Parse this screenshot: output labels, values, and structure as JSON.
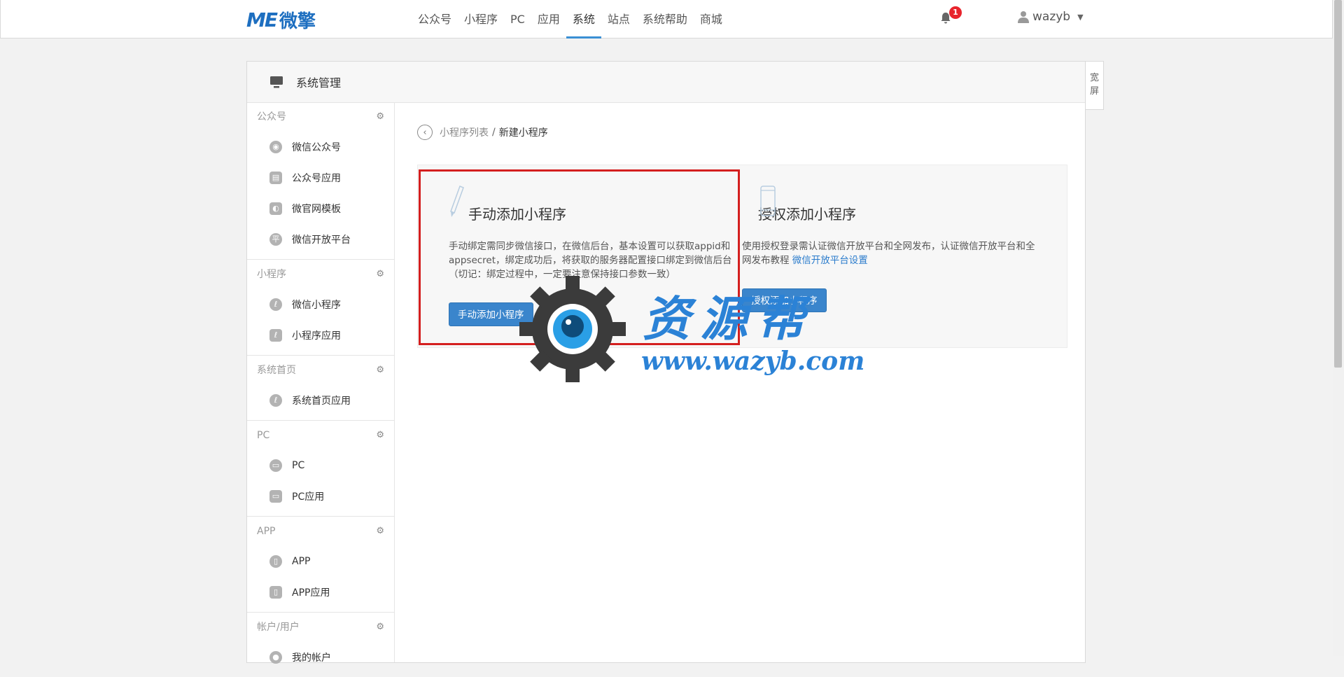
{
  "brand": {
    "mark": "ME",
    "name": "微擎"
  },
  "nav": {
    "items": [
      "公众号",
      "小程序",
      "PC",
      "应用",
      "系统",
      "站点",
      "系统帮助",
      "商城"
    ],
    "active_index": 4
  },
  "notifications": {
    "count": "1"
  },
  "user": {
    "name": "wazyb"
  },
  "panel": {
    "title": "系统管理",
    "wide_toggle": "宽屏"
  },
  "sidebar": {
    "groups": [
      {
        "title": "公众号",
        "items": [
          "微信公众号",
          "公众号应用",
          "微官网模板",
          "微信开放平台"
        ]
      },
      {
        "title": "小程序",
        "items": [
          "微信小程序",
          "小程序应用"
        ]
      },
      {
        "title": "系统首页",
        "items": [
          "系统首页应用"
        ]
      },
      {
        "title": "PC",
        "items": [
          "PC",
          "PC应用"
        ]
      },
      {
        "title": "APP",
        "items": [
          "APP",
          "APP应用"
        ]
      },
      {
        "title": "帐户/用户",
        "items": [
          "我的帐户"
        ]
      }
    ]
  },
  "breadcrumb": {
    "parent": "小程序列表",
    "separator": "/",
    "current": "新建小程序"
  },
  "cards": {
    "manual": {
      "title": "手动添加小程序",
      "desc": "手动绑定需同步微信接口，在微信后台，基本设置可以获取appid和appsecret，绑定成功后，将获取的服务器配置接口绑定到微信后台（切记：绑定过程中，一定要注意保持接口参数一致）",
      "button": "手动添加小程序"
    },
    "auth": {
      "title": "授权添加小程序",
      "desc": "使用授权登录需认证微信开放平台和全网发布，认证微信开放平台和全网发布教程",
      "link": "微信开放平台设置",
      "button": "授权添加小程序"
    }
  },
  "watermark": {
    "title": "资源帮",
    "url": "www.wazyb.com"
  },
  "colors": {
    "accent": "#3a85cc",
    "highlight": "#d41f1f",
    "badge": "#e8242c"
  }
}
